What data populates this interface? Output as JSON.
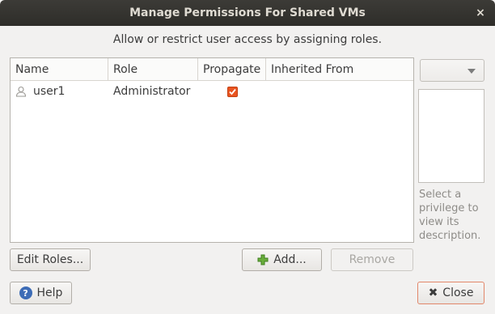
{
  "window": {
    "title": "Manage Permissions For Shared VMs",
    "close_glyph": "×"
  },
  "instructions": "Allow or restrict user access by assigning roles.",
  "table": {
    "columns": [
      "Name",
      "Role",
      "Propagate",
      "Inherited From"
    ],
    "rows": [
      {
        "name": "user1",
        "role": "Administrator",
        "propagate": true,
        "inherited_from": ""
      }
    ]
  },
  "privilege_panel": {
    "selected": "",
    "description_placeholder": "Select a privilege to view its description."
  },
  "buttons": {
    "edit_roles": "Edit Roles...",
    "add": "Add...",
    "remove": "Remove",
    "help": "Help",
    "close": "Close"
  },
  "colors": {
    "accent": "#e95420",
    "help_icon": "#3d6cb6",
    "add_icon": "#6aae3c"
  }
}
